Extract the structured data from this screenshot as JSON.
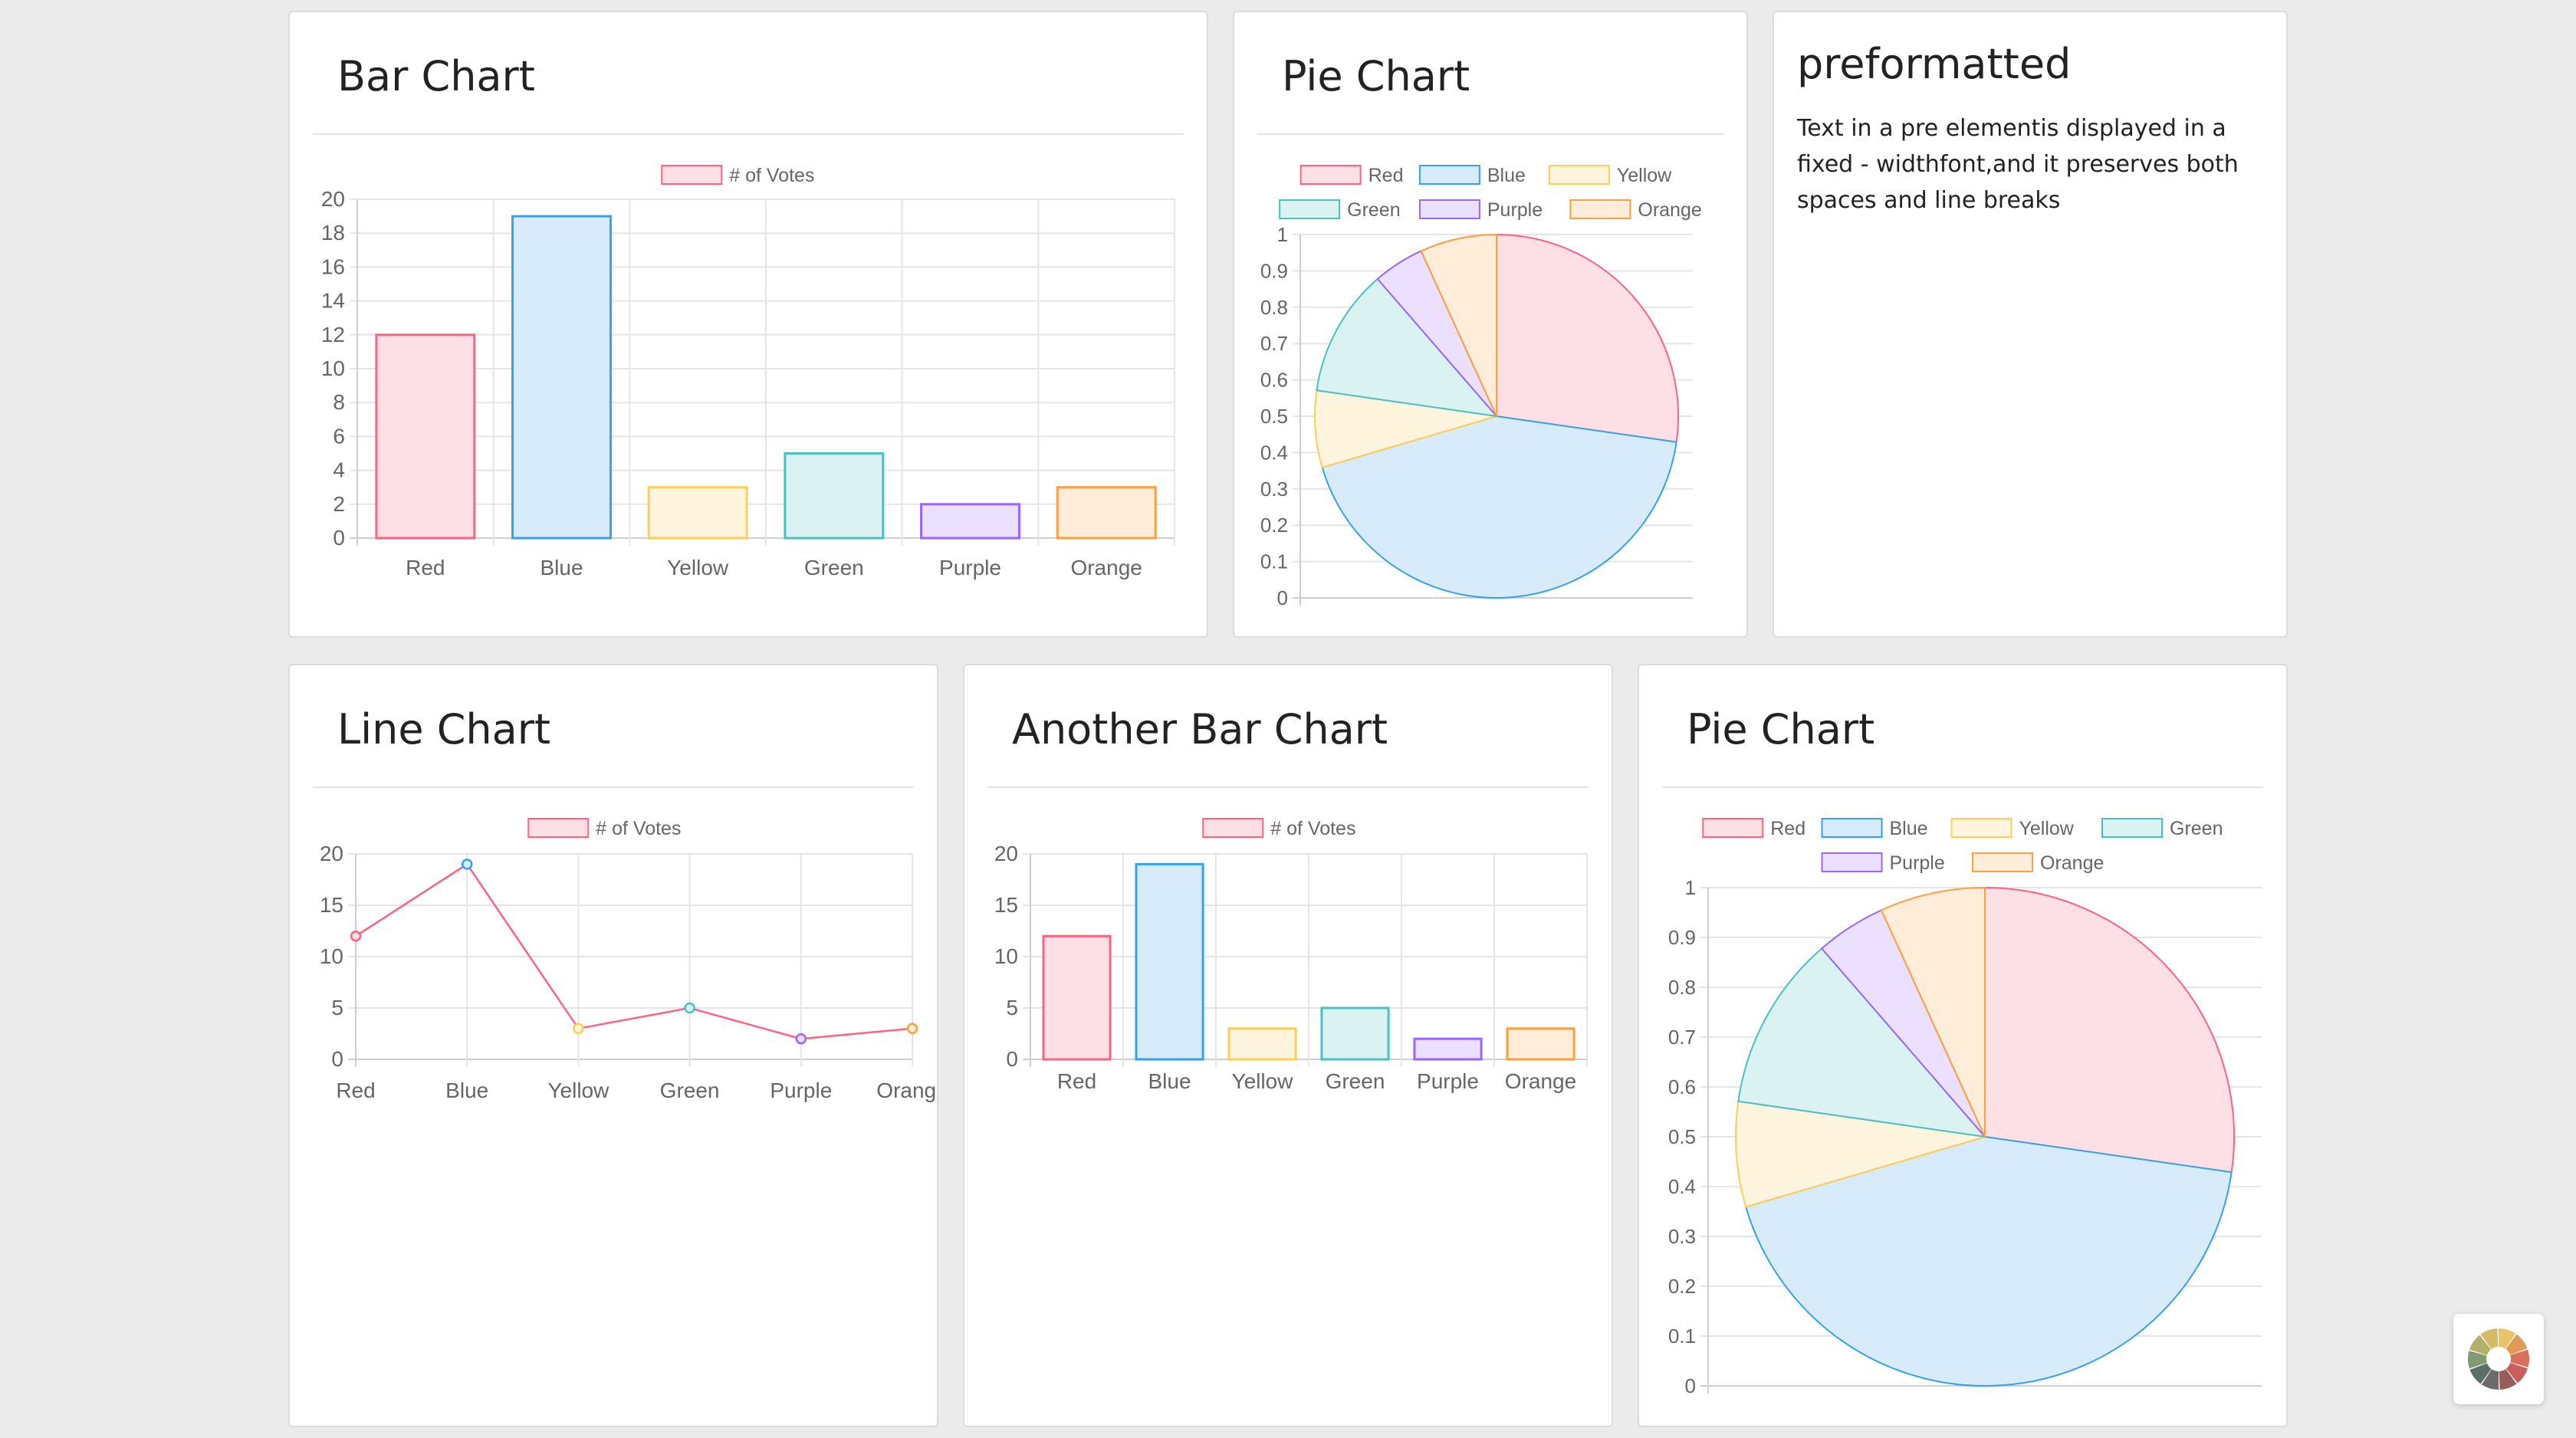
{
  "cards": {
    "bar1": {
      "title": "Bar Chart"
    },
    "pie1": {
      "title": "Pie Chart"
    },
    "pre": {
      "title": "preformatted",
      "text": "Text in a pre elementis displayed in a fixed - widthfont,and it preserves both spaces and line breaks"
    },
    "line": {
      "title": "Line Chart"
    },
    "bar2": {
      "title": "Another Bar Chart"
    },
    "pie2": {
      "title": "Pie Chart"
    }
  },
  "palette": {
    "Red": {
      "border": "#ff6384",
      "fill": "#fde0e6"
    },
    "Blue": {
      "border": "#36a2eb",
      "fill": "#d7ebfb"
    },
    "Yellow": {
      "border": "#ffce56",
      "fill": "#fff4dd"
    },
    "Green": {
      "border": "#4bc0c0",
      "fill": "#dbf2f2"
    },
    "Purple": {
      "border": "#9966ff",
      "fill": "#ebe0ff"
    },
    "Orange": {
      "border": "#ff9f40",
      "fill": "#ffecd9"
    }
  },
  "fab": {
    "icon": "color-wheel-icon"
  },
  "chart_data": [
    {
      "id": "bar1",
      "type": "bar",
      "categories": [
        "Red",
        "Blue",
        "Yellow",
        "Green",
        "Purple",
        "Orange"
      ],
      "series": [
        {
          "name": "# of Votes",
          "values": [
            12,
            19,
            3,
            5,
            2,
            3
          ]
        }
      ],
      "ylim": [
        0,
        20
      ],
      "yticks": [
        0,
        2,
        4,
        6,
        8,
        10,
        12,
        14,
        16,
        18,
        20
      ],
      "grid": true,
      "legend": "top"
    },
    {
      "id": "pie1",
      "type": "pie",
      "categories": [
        "Red",
        "Blue",
        "Yellow",
        "Green",
        "Purple",
        "Orange"
      ],
      "values": [
        12,
        19,
        3,
        5,
        2,
        3
      ],
      "yticks": [
        0,
        0.1,
        0.2,
        0.3,
        0.4,
        0.5,
        0.6,
        0.7,
        0.8,
        0.9,
        1
      ],
      "grid": true,
      "legend": "top"
    },
    {
      "id": "line",
      "type": "line",
      "categories": [
        "Red",
        "Blue",
        "Yellow",
        "Green",
        "Purple",
        "Orange"
      ],
      "series": [
        {
          "name": "# of Votes",
          "values": [
            12,
            19,
            3,
            5,
            2,
            3
          ]
        }
      ],
      "ylim": [
        0,
        20
      ],
      "yticks": [
        0,
        5,
        10,
        15,
        20
      ],
      "grid": true,
      "legend": "top"
    },
    {
      "id": "bar2",
      "type": "bar",
      "categories": [
        "Red",
        "Blue",
        "Yellow",
        "Green",
        "Purple",
        "Orange"
      ],
      "series": [
        {
          "name": "# of Votes",
          "values": [
            12,
            19,
            3,
            5,
            2,
            3
          ]
        }
      ],
      "ylim": [
        0,
        20
      ],
      "yticks": [
        0,
        5,
        10,
        15,
        20
      ],
      "grid": true,
      "legend": "top"
    },
    {
      "id": "pie2",
      "type": "pie",
      "categories": [
        "Red",
        "Blue",
        "Yellow",
        "Green",
        "Purple",
        "Orange"
      ],
      "values": [
        12,
        19,
        3,
        5,
        2,
        3
      ],
      "yticks": [
        0,
        0.1,
        0.2,
        0.3,
        0.4,
        0.5,
        0.6,
        0.7,
        0.8,
        0.9,
        1
      ],
      "grid": true,
      "legend": "top"
    }
  ]
}
